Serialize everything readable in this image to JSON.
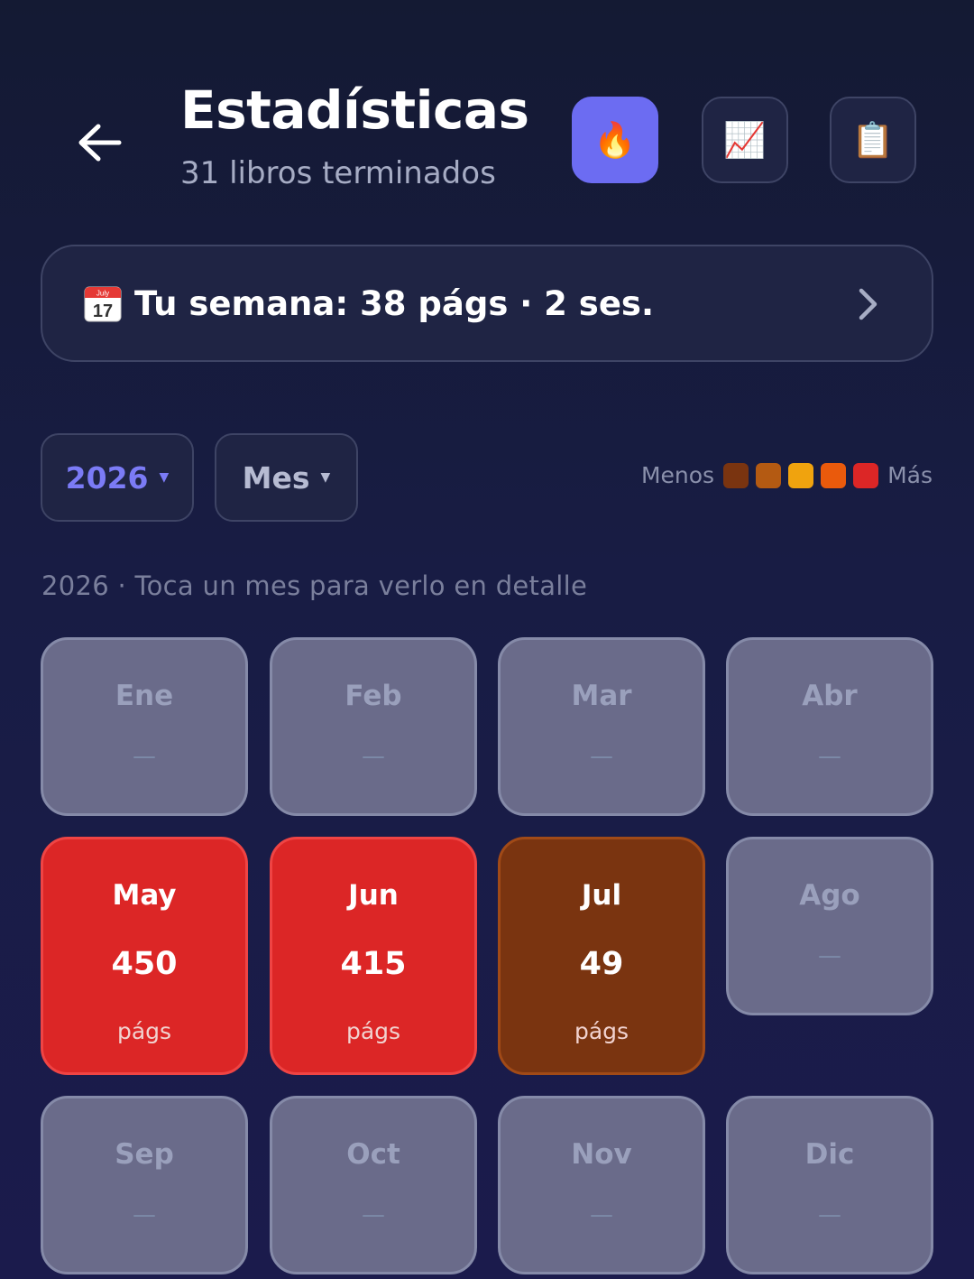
{
  "header": {
    "title": "Estadísticas",
    "subtitle": "31 libros terminados",
    "back_icon": "arrow-left-icon",
    "actions": [
      {
        "icon": "fire-icon",
        "glyph": "🔥",
        "active": true
      },
      {
        "icon": "chart-increasing-icon",
        "glyph": "📈",
        "active": false
      },
      {
        "icon": "clipboard-icon",
        "glyph": "📋",
        "active": false
      }
    ]
  },
  "week": {
    "icon": "calendar-icon",
    "calendar_month": "July",
    "calendar_day": "17",
    "text": "Tu semana: 38 págs · 2 ses."
  },
  "filters": {
    "year": "2026",
    "period": "Mes",
    "caret": "▼"
  },
  "legend": {
    "less": "Menos",
    "more": "Más",
    "colors": [
      "#7a3410",
      "#b45a12",
      "#f0a30e",
      "#ea5a0c",
      "#dc2626"
    ]
  },
  "hint": "2026 · Toca un mes para verlo en detalle",
  "months": [
    {
      "name": "Ene",
      "empty_marker": "—"
    },
    {
      "name": "Feb",
      "empty_marker": "—"
    },
    {
      "name": "Mar",
      "empty_marker": "—"
    },
    {
      "name": "Abr",
      "empty_marker": "—"
    },
    {
      "name": "May",
      "value": "450",
      "unit": "págs",
      "color": "#dc2626",
      "border": "#ef4444"
    },
    {
      "name": "Jun",
      "value": "415",
      "unit": "págs",
      "color": "#dc2626",
      "border": "#ef4444"
    },
    {
      "name": "Jul",
      "value": "49",
      "unit": "págs",
      "color": "#7a3410",
      "border": "#a14a17"
    },
    {
      "name": "Ago",
      "empty_marker": "—"
    },
    {
      "name": "Sep",
      "empty_marker": "—"
    },
    {
      "name": "Oct",
      "empty_marker": "—"
    },
    {
      "name": "Nov",
      "empty_marker": "—"
    },
    {
      "name": "Dic",
      "empty_marker": "—"
    }
  ]
}
